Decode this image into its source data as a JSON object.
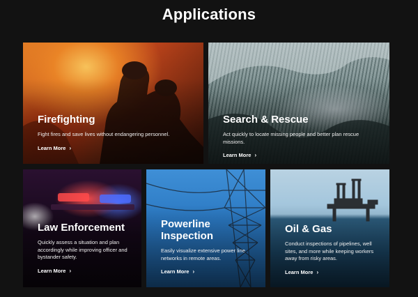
{
  "page": {
    "title": "Applications"
  },
  "cards": [
    {
      "title": "Firefighting",
      "description": "Fight fires and save lives without endangering personnel.",
      "link": "Learn More",
      "image": "firefighters-in-flames"
    },
    {
      "title": "Search & Rescue",
      "description": "Act quickly to locate missing people and better plan rescue missions.",
      "link": "Learn More",
      "image": "snowy-forest-mountains"
    },
    {
      "title": "Law Enforcement",
      "description": "Quickly assess a situation and plan accordingly while improving officer and bystander safety.",
      "link": "Learn More",
      "image": "police-lights"
    },
    {
      "title": "Powerline Inspection",
      "description": "Easily visualize extensive power line networks in remote areas.",
      "link": "Learn More",
      "image": "transmission-tower"
    },
    {
      "title": "Oil & Gas",
      "description": "Conduct inspections of pipelines, well sites, and more while keeping workers away from risky areas.",
      "link": "Learn More",
      "image": "offshore-oil-rig"
    }
  ],
  "icons": {
    "link_chevron": "chevron-right-icon"
  }
}
